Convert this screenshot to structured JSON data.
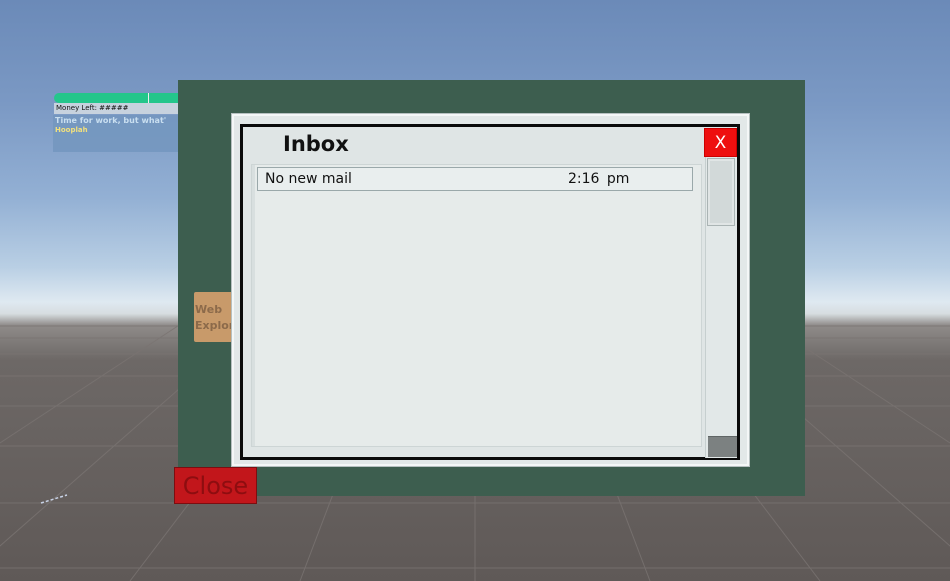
{
  "hud": {
    "money_label": "Money Left: #####",
    "message_line1": "Time for work, but what'",
    "message_line2": "Hooplah"
  },
  "backboard": {
    "web_explorer_label": "Web\nExplor",
    "close_label": "Close"
  },
  "inbox": {
    "title": "Inbox",
    "close_label": "X",
    "messages": [
      {
        "subject": "No new mail",
        "time": "2:16 pm"
      }
    ]
  },
  "colors": {
    "sky_top": "#6b8ab8",
    "ground": "#5f5957",
    "backboard": "#3d5e4f",
    "close_red": "#c2161b",
    "x_red": "#ee0f0f",
    "health_green": "#24c68b"
  }
}
